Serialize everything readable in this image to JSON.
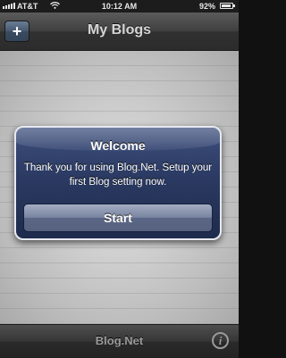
{
  "status_bar": {
    "carrier": "AT&T",
    "time": "10:12 AM",
    "battery_percent": "92%",
    "battery_level": 0.92,
    "icons": [
      "signal-icon",
      "wifi-icon",
      "battery-icon"
    ]
  },
  "nav_bar": {
    "title": "My Blogs",
    "add_button_label": "+"
  },
  "alert": {
    "title": "Welcome",
    "message": "Thank you for using Blog.Net. Setup your first Blog setting now.",
    "button_label": "Start"
  },
  "bottom_bar": {
    "label": "Blog.Net",
    "info_icon_glyph": "i"
  },
  "colors": {
    "alert_background": "#2b3a62",
    "nav_button": "#47596f"
  }
}
